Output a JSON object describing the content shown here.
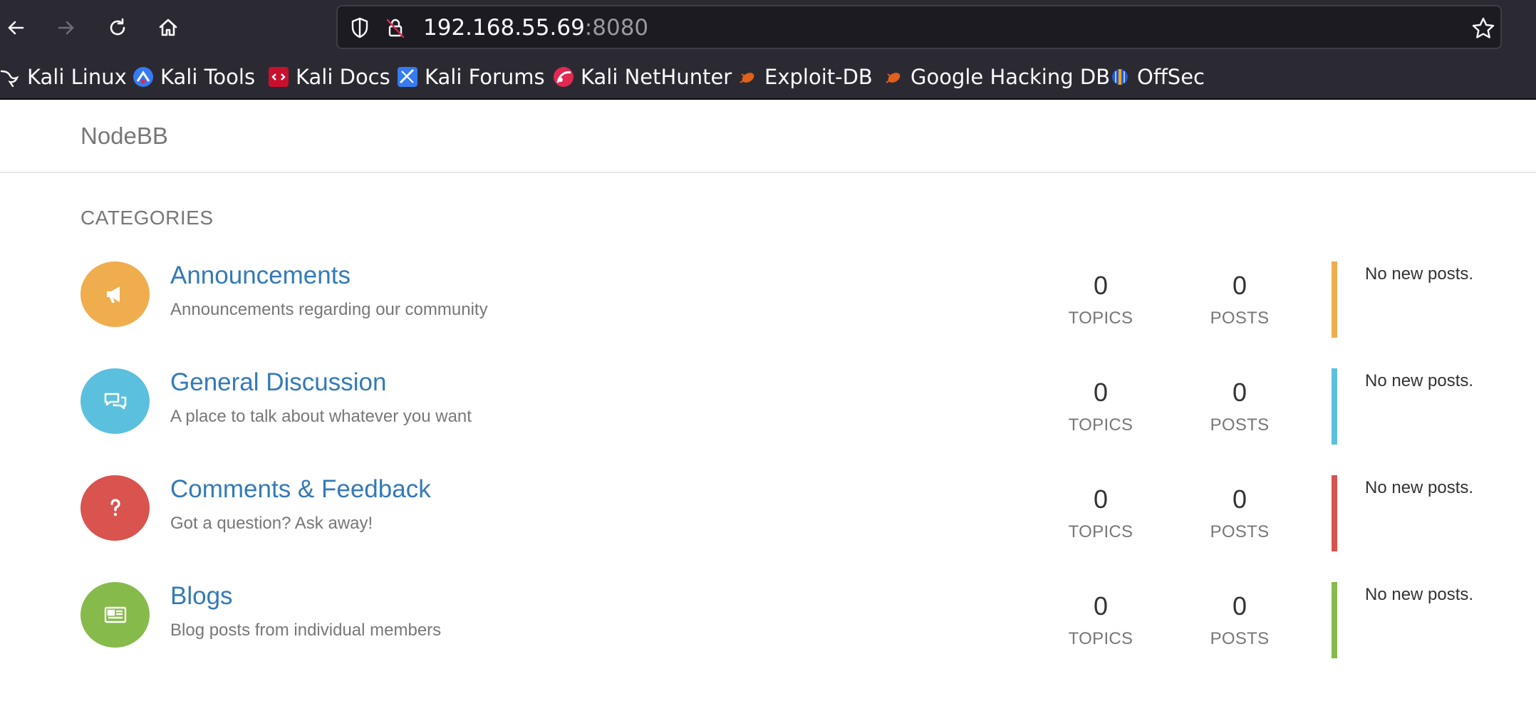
{
  "browser": {
    "url_host": "192.168.55.69",
    "url_port": ":8080",
    "bookmarks": [
      {
        "label": "Kali Linux",
        "icon": "kali-dragon-icon"
      },
      {
        "label": "Kali Tools",
        "icon": "kali-tools-icon"
      },
      {
        "label": "Kali Docs",
        "icon": "kali-docs-icon"
      },
      {
        "label": "Kali Forums",
        "icon": "kali-forums-icon"
      },
      {
        "label": "Kali NetHunter",
        "icon": "kali-nethunter-icon"
      },
      {
        "label": "Exploit-DB",
        "icon": "exploit-db-icon"
      },
      {
        "label": "Google Hacking DB",
        "icon": "google-hacking-db-icon"
      },
      {
        "label": "OffSec",
        "icon": "offsec-icon"
      }
    ]
  },
  "site": {
    "brand": "NodeBB",
    "categories_heading": "CATEGORIES",
    "categories": [
      {
        "title": "Announcements",
        "description": "Announcements regarding our community",
        "topics": "0",
        "posts": "0",
        "topics_label": "TOPICS",
        "posts_label": "POSTS",
        "last_post": "No new posts.",
        "color": "#f0ad4e",
        "icon": "bullhorn-icon"
      },
      {
        "title": "General Discussion",
        "description": "A place to talk about whatever you want",
        "topics": "0",
        "posts": "0",
        "topics_label": "TOPICS",
        "posts_label": "POSTS",
        "last_post": "No new posts.",
        "color": "#5bc0de",
        "icon": "chat-bubbles-icon"
      },
      {
        "title": "Comments & Feedback",
        "description": "Got a question? Ask away!",
        "topics": "0",
        "posts": "0",
        "topics_label": "TOPICS",
        "posts_label": "POSTS",
        "last_post": "No new posts.",
        "color": "#d9534f",
        "icon": "question-icon"
      },
      {
        "title": "Blogs",
        "description": "Blog posts from individual members",
        "topics": "0",
        "posts": "0",
        "topics_label": "TOPICS",
        "posts_label": "POSTS",
        "last_post": "No new posts.",
        "color": "#86ba4b",
        "icon": "newspaper-icon"
      }
    ]
  }
}
